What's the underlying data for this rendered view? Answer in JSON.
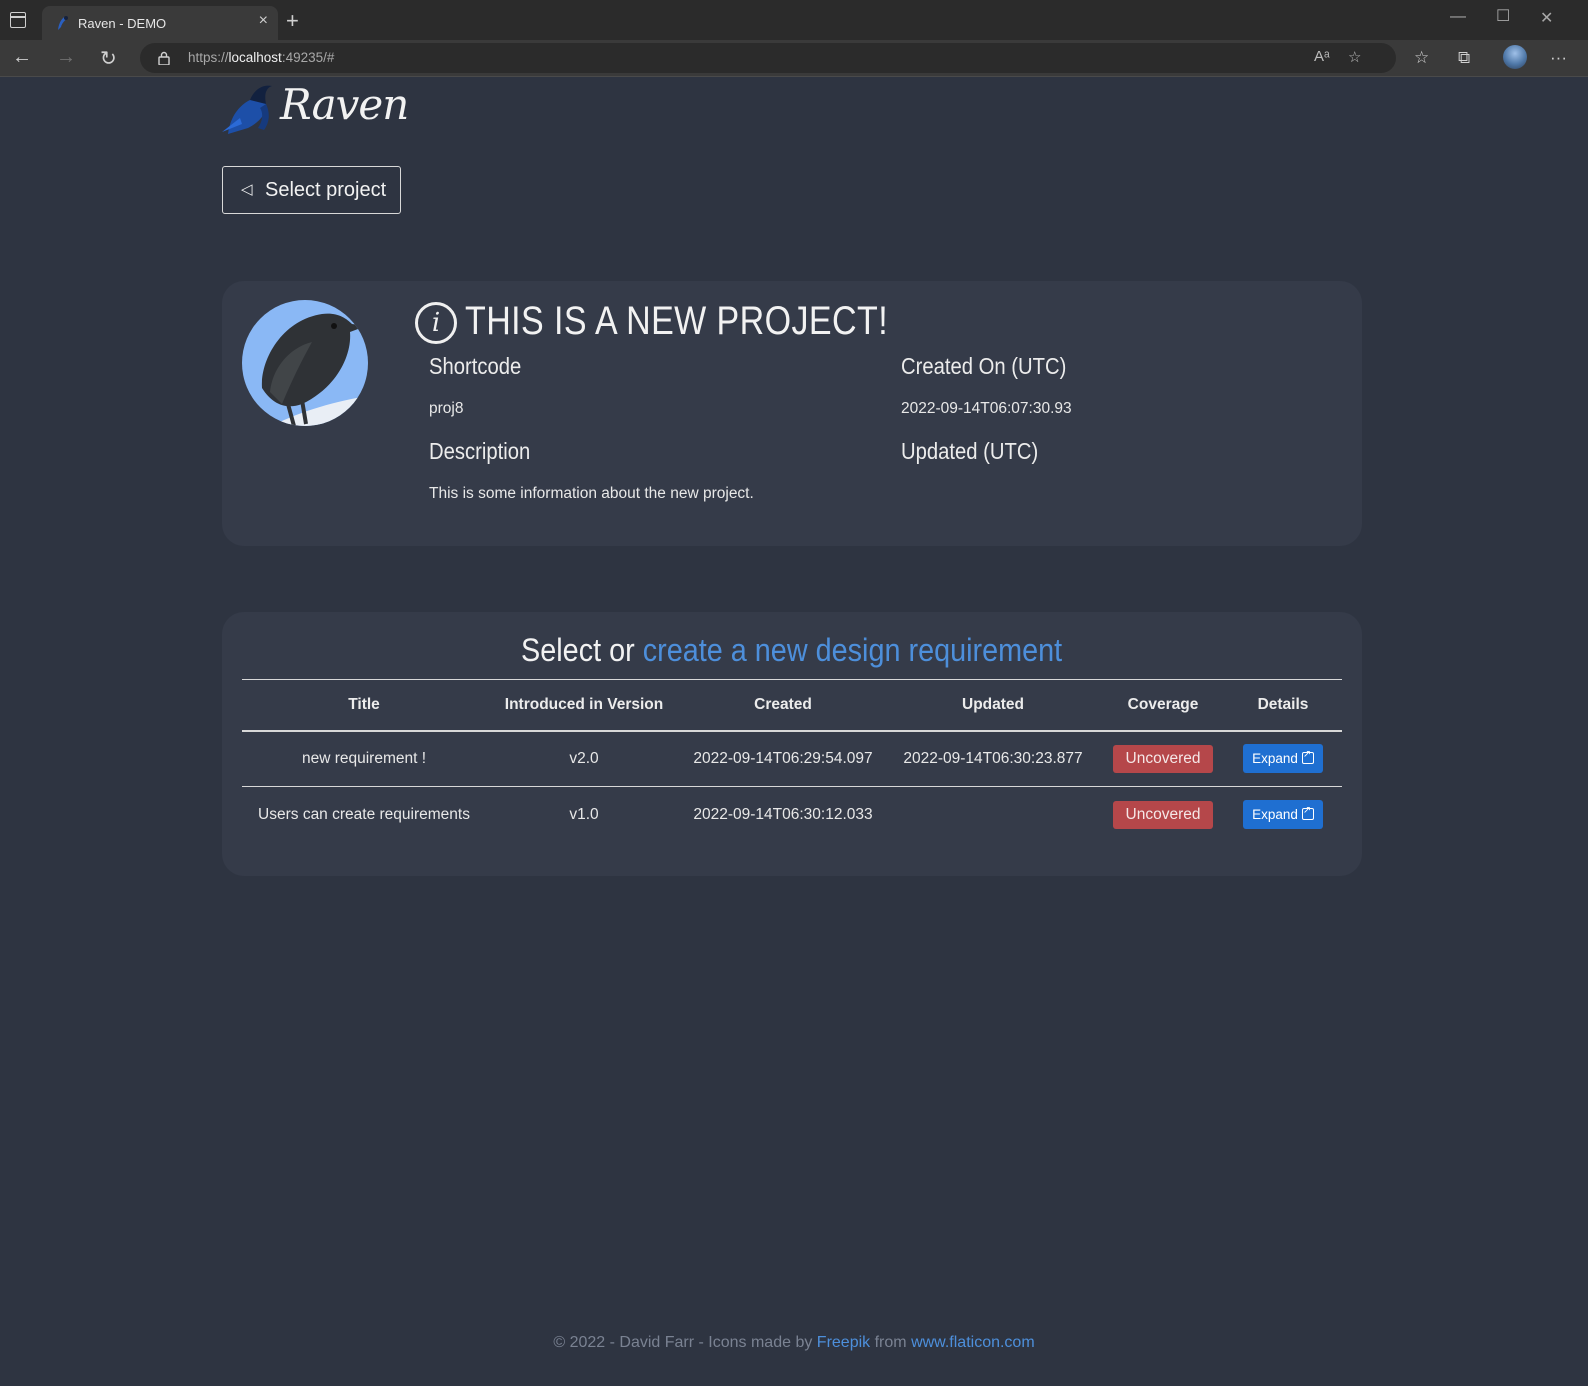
{
  "browser": {
    "tab_title": "Raven - DEMO",
    "url_prefix": "https://",
    "url_host": "localhost",
    "url_rest": ":49235/#"
  },
  "header": {
    "logo_text": "Raven",
    "back_button_label": "Select project"
  },
  "project": {
    "heading": "THIS IS A NEW PROJECT!",
    "shortcode_label": "Shortcode",
    "shortcode_value": "proj8",
    "created_label": "Created On (UTC)",
    "created_value": "2022-09-14T06:07:30.93",
    "description_label": "Description",
    "description_value": "This is some information about the new project.",
    "updated_label": "Updated (UTC)",
    "updated_value": ""
  },
  "requirements": {
    "heading_prefix": "Select or",
    "heading_link": "create a new design requirement",
    "columns": [
      "Title",
      "Introduced in Version",
      "Created",
      "Updated",
      "Coverage",
      "Details"
    ],
    "rows": [
      {
        "title": "new requirement !",
        "version": "v2.0",
        "created": "2022-09-14T06:29:54.097",
        "updated": "2022-09-14T06:30:23.877",
        "coverage": "Uncovered",
        "details": "Expand"
      },
      {
        "title": "Users can create requirements",
        "version": "v1.0",
        "created": "2022-09-14T06:30:12.033",
        "updated": "",
        "coverage": "Uncovered",
        "details": "Expand"
      }
    ]
  },
  "footer": {
    "text": "© 2022 - David Farr - Icons made by",
    "link1": "Freepik",
    "middle": "from",
    "link2": "www.flaticon.com"
  },
  "colors": {
    "page_bg": "#2e3441",
    "card_bg": "#353b49",
    "link": "#4d8fdb",
    "badge_uncovered": "#b5474a",
    "button_primary": "#1f6fd1"
  }
}
